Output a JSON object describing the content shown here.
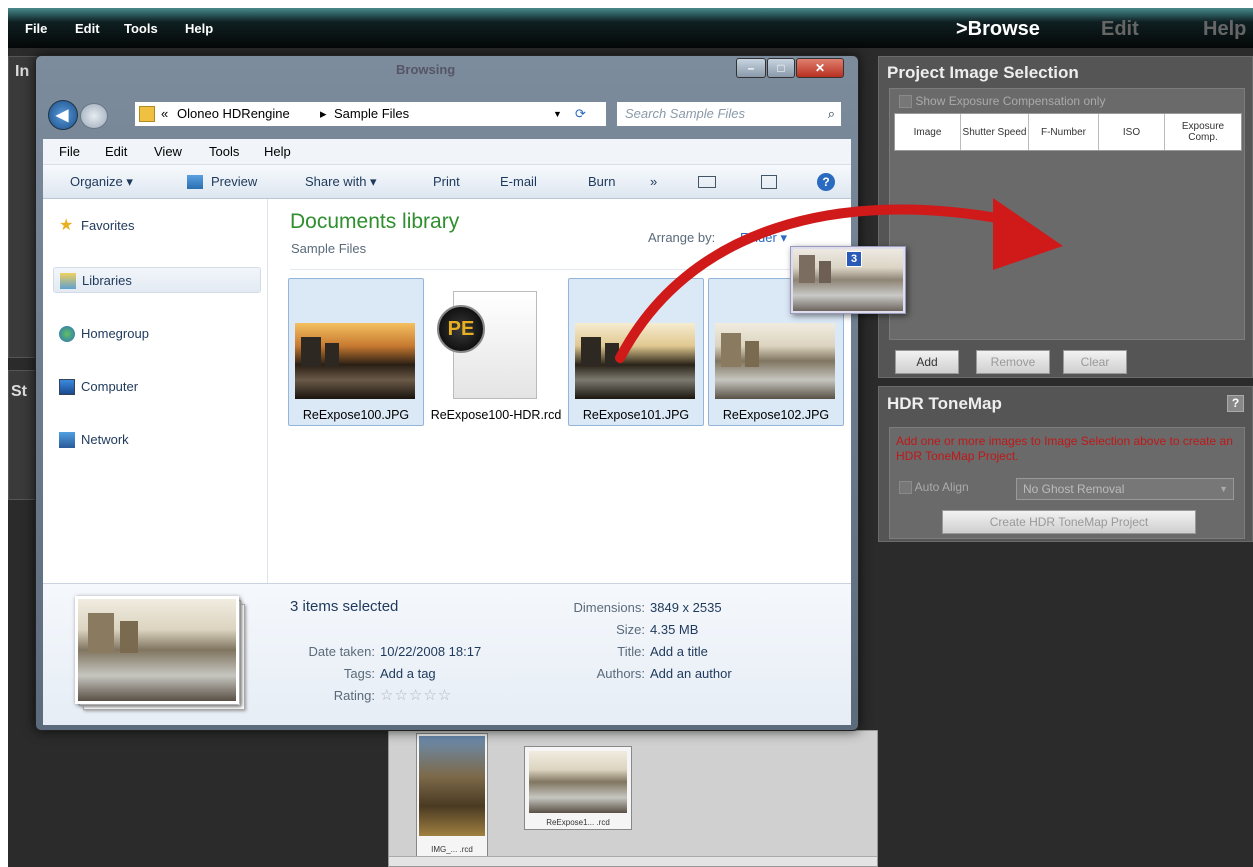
{
  "app_menu": [
    "File",
    "Edit",
    "Tools",
    "Help"
  ],
  "nav": {
    "browse": ">Browse",
    "edit": "Edit",
    "help": "Help"
  },
  "left_panel": {
    "title_fragment": "In",
    "panel2_fragment": "St"
  },
  "project_image_selection": {
    "title": "Project Image Selection",
    "show_exposure_label": "Show Exposure Compensation only",
    "columns": [
      "Image",
      "Shutter Speed",
      "F-Number",
      "ISO",
      "Exposure Comp."
    ],
    "buttons": {
      "add": "Add",
      "remove": "Remove",
      "clear": "Clear"
    }
  },
  "hdr_tonemap": {
    "title": "HDR ToneMap",
    "help_label": "?",
    "message": "Add one or more images to Image Selection above to create an HDR ToneMap Project.",
    "auto_align_label": "Auto Align",
    "ghost_select_value": "No Ghost Removal",
    "create_button": "Create HDR ToneMap Project"
  },
  "explorer": {
    "title_fragment": "Browsing",
    "address_parts": [
      "«",
      "Oloneo HDRengine",
      "▸",
      "Sample Files"
    ],
    "search_placeholder": "Search Sample Files",
    "menu": [
      "File",
      "Edit",
      "View",
      "Tools",
      "Help"
    ],
    "toolbar": [
      "Organize ▾",
      "Preview",
      "Share with ▾",
      "Print",
      "E-mail",
      "Burn",
      "»"
    ],
    "nav_items": [
      "Favorites",
      "Libraries",
      "Homegroup",
      "Computer",
      "Network"
    ],
    "library_title": "Documents library",
    "library_subtitle": "Sample Files",
    "arrange_label": "Arrange by:",
    "arrange_value": "Folder ▾",
    "files": [
      {
        "name": "ReExpose100.JPG",
        "selected": true
      },
      {
        "name": "ReExpose100-HDR.rcd",
        "selected": false
      },
      {
        "name": "ReExpose101.JPG",
        "selected": true
      },
      {
        "name": "ReExpose102.JPG",
        "selected": true
      }
    ],
    "pe_label": "PE",
    "drag_count": "3",
    "details": {
      "selected_text": "3 items selected",
      "date_taken_label": "Date taken:",
      "date_taken": "10/22/2008 18:17",
      "tags_label": "Tags:",
      "tags": "Add a tag",
      "rating_label": "Rating:",
      "rating_stars": "☆☆☆☆☆",
      "dimensions_label": "Dimensions:",
      "dimensions": "3849 x 2535",
      "size_label": "Size:",
      "size": "4.35 MB",
      "title_label": "Title:",
      "title": "Add a title",
      "authors_label": "Authors:",
      "authors": "Add an author"
    }
  },
  "filmstrip": [
    {
      "label": "IMG_... .rcd"
    },
    {
      "label": "ReExpose1... .rcd"
    }
  ],
  "colors": {
    "arrow": "#d01a1a",
    "accent_link": "#2f8f2f",
    "nav_active": "#ffffff"
  }
}
